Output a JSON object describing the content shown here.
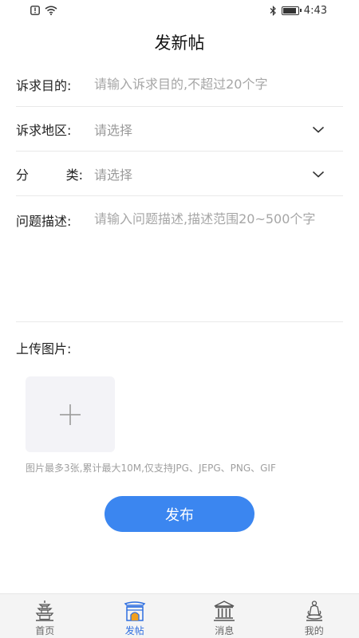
{
  "status": {
    "time": "4:43"
  },
  "page": {
    "title": "发新帖"
  },
  "form": {
    "purpose": {
      "label": "诉求目的:",
      "placeholder": "请输入诉求目的,不超过20个字"
    },
    "region": {
      "label": "诉求地区:",
      "placeholder": "请选择"
    },
    "category": {
      "label_left": "分",
      "label_right": "类:",
      "placeholder": "请选择"
    },
    "description": {
      "label": "问题描述:",
      "placeholder": "请输入问题描述,描述范围20~500个字"
    }
  },
  "upload": {
    "label": "上传图片:",
    "hint": "图片最多3张,累计最大10M,仅支持JPG、JEPG、PNG、GIF"
  },
  "actions": {
    "publish": "发布"
  },
  "tabbar": {
    "items": [
      {
        "label": "首页",
        "icon": "pagoda-icon",
        "active": false
      },
      {
        "label": "发帖",
        "icon": "gate-icon",
        "active": true
      },
      {
        "label": "消息",
        "icon": "temple-icon",
        "active": false
      },
      {
        "label": "我的",
        "icon": "statue-icon",
        "active": false
      }
    ]
  },
  "colors": {
    "accent": "#3b86f0",
    "active_tab": "#2e6fe0",
    "placeholder": "#a6a6a6"
  }
}
